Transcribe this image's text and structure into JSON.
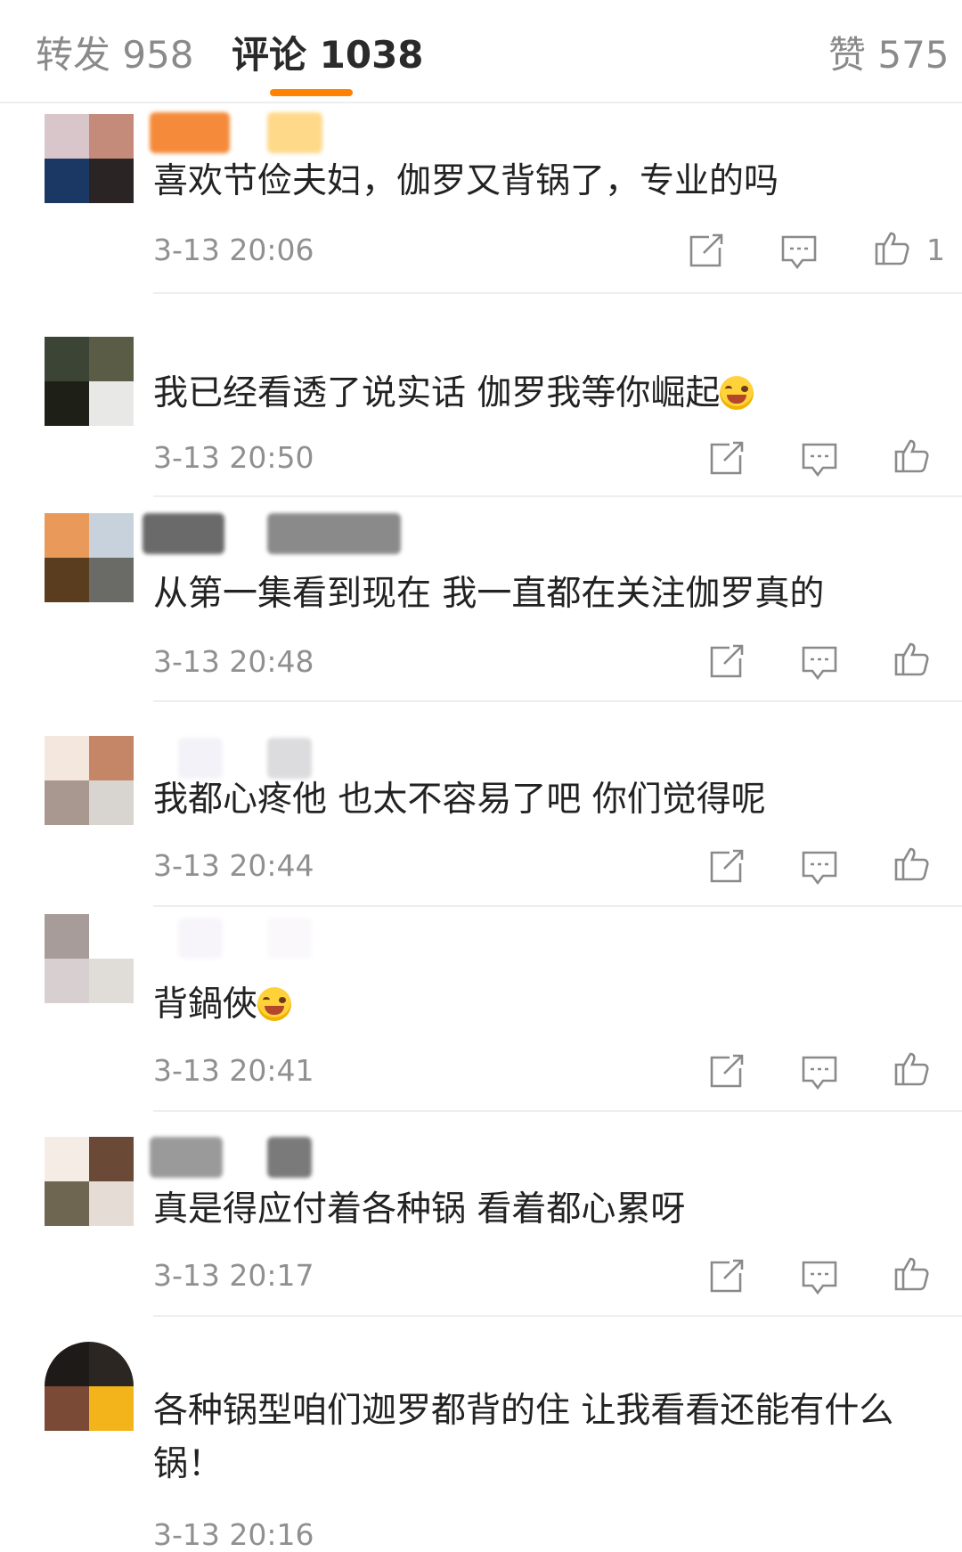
{
  "tabs": {
    "reposts": "转发 958",
    "comments": "评论 1038",
    "likes": "赞 575"
  },
  "colors": {
    "accent": "#ff8200",
    "text": "#222222",
    "muted": "#909090"
  },
  "icons": {
    "share": "share-icon",
    "reply": "comment-icon",
    "like": "thumbs-up-icon"
  },
  "comments": [
    {
      "text": "喜欢节俭夫妇，伽罗又背锅了，专业的吗",
      "time": "3-13 20:06",
      "likes": "1"
    },
    {
      "text": "我已经看透了说实话 伽罗我等你崛起",
      "emoji": "laugh-cry-emoji",
      "time": "3-13 20:50",
      "likes": ""
    },
    {
      "text": "从第一集看到现在 我一直都在关注伽罗真的",
      "time": "3-13 20:48",
      "likes": ""
    },
    {
      "text": "我都心疼他 也太不容易了吧 你们觉得呢",
      "time": "3-13 20:44",
      "likes": ""
    },
    {
      "text": "背鍋俠",
      "emoji": "laugh-cry-emoji",
      "time": "3-13 20:41",
      "likes": ""
    },
    {
      "text": "真是得应付着各种锅 看着都心累呀",
      "time": "3-13 20:17",
      "likes": ""
    },
    {
      "text": "各种锅型咱们迦罗都背的住 让我看看还能有什么锅！",
      "time": "3-13 20:16",
      "likes": ""
    }
  ]
}
